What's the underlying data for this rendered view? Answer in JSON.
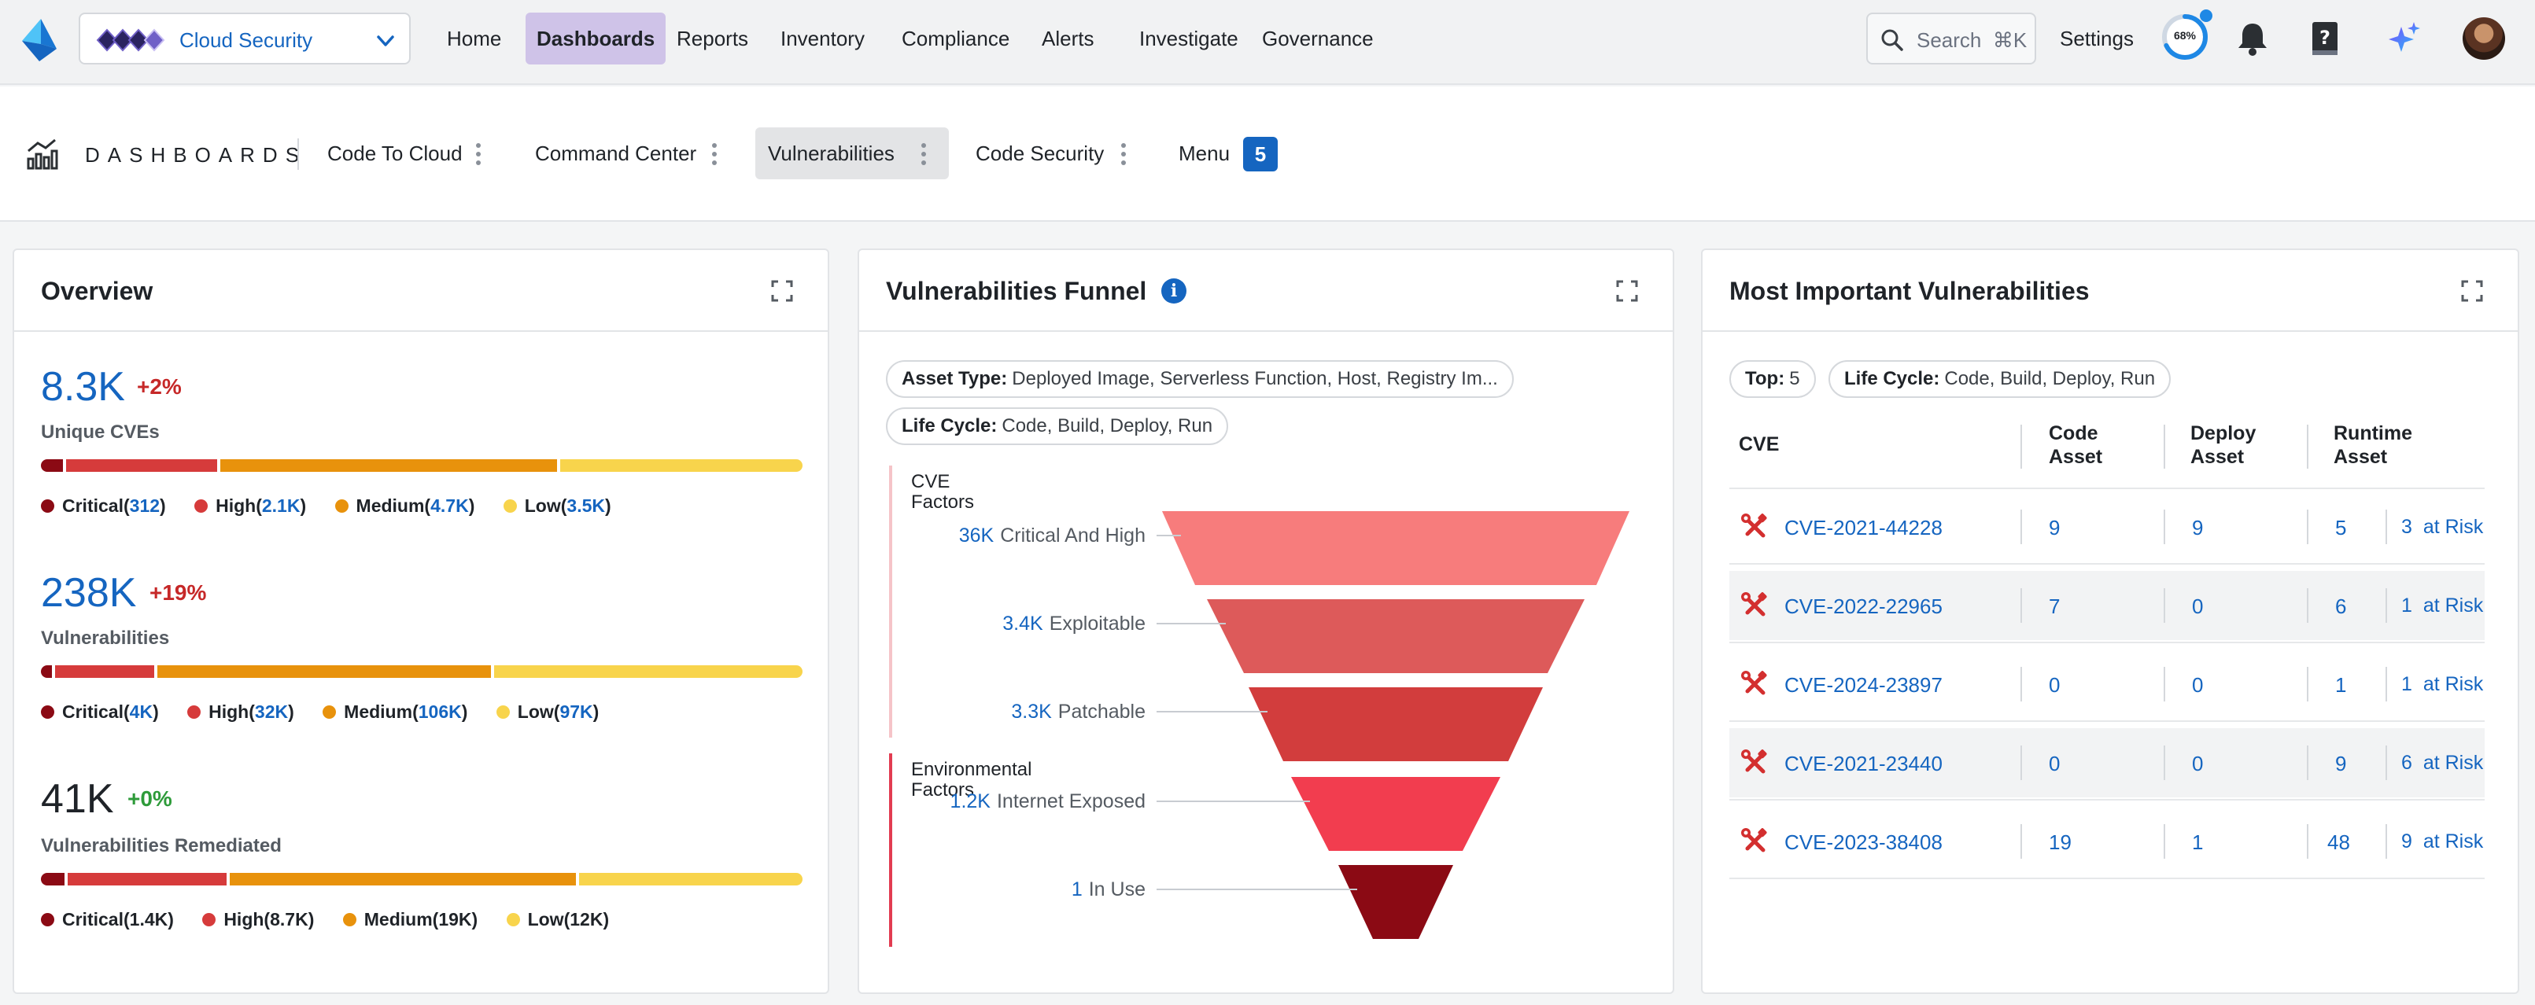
{
  "nav": {
    "product": "Cloud Security",
    "items": [
      "Home",
      "Dashboards",
      "Reports",
      "Inventory",
      "Compliance",
      "Alerts",
      "Investigate",
      "Governance"
    ],
    "active_index": 1,
    "search_placeholder": "Search",
    "search_shortcut": "⌘K",
    "settings": "Settings",
    "progress_label": "68%",
    "progress": 0.68
  },
  "tabs": {
    "title": "DASHBOARDS",
    "items": [
      "Code To Cloud",
      "Command Center",
      "Vulnerabilities",
      "Code Security",
      "Menu"
    ],
    "active_index": 2,
    "menu_count": "5"
  },
  "overview": {
    "title": "Overview",
    "metrics": [
      {
        "value": "8.3K",
        "delta": "+2%",
        "label": "Unique CVEs",
        "legend": [
          {
            "name": "Critical",
            "value": "312"
          },
          {
            "name": "High",
            "value": "2.1K"
          },
          {
            "name": "Medium",
            "value": "4.7K"
          },
          {
            "name": "Low",
            "value": "3.5K"
          }
        ]
      },
      {
        "value": "238K",
        "delta": "+19%",
        "label": "Vulnerabilities",
        "legend": [
          {
            "name": "Critical",
            "value": "4K"
          },
          {
            "name": "High",
            "value": "32K"
          },
          {
            "name": "Medium",
            "value": "106K"
          },
          {
            "name": "Low",
            "value": "97K"
          }
        ]
      },
      {
        "value": "41K",
        "delta": "+0%",
        "label": "Vulnerabilities Remediated",
        "legend": [
          {
            "name": "Critical",
            "value": "1.4K"
          },
          {
            "name": "High",
            "value": "8.7K"
          },
          {
            "name": "Medium",
            "value": "19K"
          },
          {
            "name": "Low",
            "value": "12K"
          }
        ]
      }
    ],
    "colors": {
      "critical": "#8b0a14",
      "high": "#d63b3b",
      "medium": "#e8920c",
      "low": "#f8d44c"
    }
  },
  "funnel": {
    "title": "Vulnerabilities Funnel",
    "chips": [
      {
        "key": "Asset Type:",
        "value": "Deployed Image, Serverless Function, Host, Registry Im..."
      },
      {
        "key": "Life Cycle:",
        "value": "Code, Build, Deploy, Run"
      }
    ],
    "group_cve": [
      "CVE",
      "Factors"
    ],
    "group_env": [
      "Environmental",
      "Factors"
    ],
    "stages": [
      {
        "value": "36K",
        "label": "Critical And High",
        "color": "#f77c7c"
      },
      {
        "value": "3.4K",
        "label": "Exploitable",
        "color": "#dd5a5a"
      },
      {
        "value": "3.3K",
        "label": "Patchable",
        "color": "#d23d3d"
      },
      {
        "value": "1.2K",
        "label": "Internet Exposed",
        "color": "#f23d4f"
      },
      {
        "value": "1",
        "label": "In Use",
        "color": "#8b0a14"
      }
    ]
  },
  "mostImportant": {
    "title": "Most Important Vulnerabilities",
    "chips": [
      {
        "key": "Top:",
        "value": "5"
      },
      {
        "key": "Life Cycle:",
        "value": "Code, Build, Deploy, Run"
      }
    ],
    "headers": {
      "cve": "CVE",
      "code": [
        "Code",
        "Asset"
      ],
      "deploy": [
        "Deploy",
        "Asset"
      ],
      "runtime": [
        "Runtime",
        "Asset"
      ]
    },
    "at_risk_label": "at Risk",
    "rows": [
      {
        "cve": "CVE-2021-44228",
        "code": "9",
        "deploy": "9",
        "runtime": "5",
        "risk": "3"
      },
      {
        "cve": "CVE-2022-22965",
        "code": "7",
        "deploy": "0",
        "runtime": "6",
        "risk": "1"
      },
      {
        "cve": "CVE-2024-23897",
        "code": "0",
        "deploy": "0",
        "runtime": "1",
        "risk": "1"
      },
      {
        "cve": "CVE-2021-23440",
        "code": "0",
        "deploy": "0",
        "runtime": "9",
        "risk": "6"
      },
      {
        "cve": "CVE-2023-38408",
        "code": "19",
        "deploy": "1",
        "runtime": "48",
        "risk": "9"
      }
    ]
  }
}
